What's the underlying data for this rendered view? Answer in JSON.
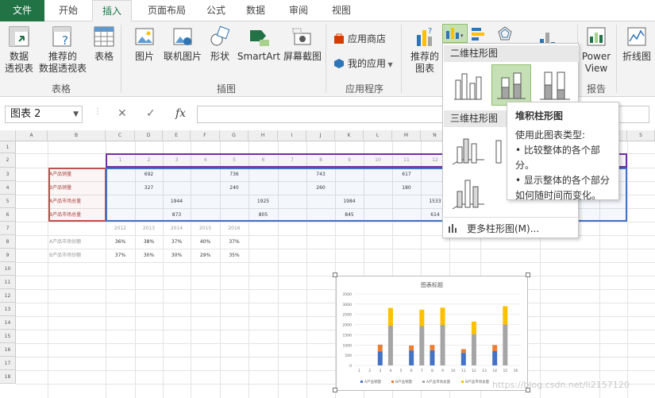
{
  "tabs": [
    {
      "label": "文件"
    },
    {
      "label": "开始"
    },
    {
      "label": "插入"
    },
    {
      "label": "页面布局"
    },
    {
      "label": "公式"
    },
    {
      "label": "数据"
    },
    {
      "label": "审阅"
    },
    {
      "label": "视图"
    }
  ],
  "ribbon": {
    "pivot_l1": "数据",
    "pivot_l2": "透视表",
    "rec_pivot_l1": "推荐的",
    "rec_pivot_l2": "数据透视表",
    "table": "表格",
    "group_tables": "表格",
    "picture": "图片",
    "online_picture": "联机图片",
    "shapes": "形状",
    "smartart": "SmartArt",
    "screenshot": "屏幕截图",
    "group_illustrations": "插图",
    "store": "应用商店",
    "my_apps": "我的应用",
    "group_apps": "应用程序",
    "rec_charts_l1": "推荐的",
    "rec_charts_l2": "图表",
    "power_view_l1": "Power",
    "power_view_l2": "View",
    "group_reports": "报告",
    "sparkline_line": "折线图"
  },
  "formula_bar": {
    "name_box": "图表 2",
    "fx": "fx",
    "cancel": "✕",
    "enter": "✓"
  },
  "column_dropdown": {
    "section_2d": "二维柱形图",
    "section_3d": "三维柱形图",
    "more": "更多柱形图(M)..."
  },
  "tooltip": {
    "title": "堆积柱形图",
    "line1": "使用此图表类型:",
    "line2": "• 比较整体的各个部",
    "line3": "分。",
    "line4": "• 显示整体的各个部分",
    "line5": "如何随时间而变化。"
  },
  "sheet": {
    "columns": [
      "A",
      "B",
      "C",
      "D",
      "E",
      "F",
      "G",
      "H",
      "I",
      "J",
      "K",
      "L",
      "M",
      "N",
      "O",
      "P",
      "Q",
      "R",
      "S"
    ],
    "rows": [
      "1",
      "2",
      "3",
      "4",
      "5",
      "6",
      "7",
      "8",
      "9",
      "10",
      "11",
      "12",
      "13",
      "14",
      "15",
      "16",
      "17",
      "18"
    ],
    "row2_nums": [
      "1",
      "2",
      "3",
      "4",
      "5",
      "6",
      "7",
      "8",
      "9",
      "10",
      "11",
      "12"
    ],
    "r3_label": "A产品销量",
    "r3": [
      "692",
      "736",
      "743",
      "617"
    ],
    "r4_label": "B产品销量",
    "r4": [
      "327",
      "240",
      "260",
      "180"
    ],
    "r5_label": "A产品市场总量",
    "r5": [
      "1944",
      "1925",
      "1984",
      "1533"
    ],
    "r6_label": "B产品市场总量",
    "r6": [
      "873",
      "805",
      "845",
      "614"
    ],
    "years": [
      "2012",
      "2013",
      "2014",
      "2015",
      "2016"
    ],
    "r8_label": "A产品市场份额",
    "r8": [
      "36%",
      "38%",
      "37%",
      "40%",
      "37%"
    ],
    "r9_label": "B产品市场份额",
    "r9": [
      "37%",
      "30%",
      "30%",
      "29%",
      "35%"
    ]
  },
  "chart_data": {
    "type": "bar",
    "title": "图表标题",
    "stacked": true,
    "x": [
      "1",
      "2",
      "3",
      "4",
      "5",
      "6",
      "7",
      "8",
      "9",
      "10",
      "11",
      "12",
      "13",
      "14",
      "15",
      "16"
    ],
    "ylim": [
      0,
      3500
    ],
    "yticks": [
      0,
      500,
      1000,
      1500,
      2000,
      2500,
      3000,
      3500
    ],
    "series": [
      {
        "name": "A产品销量",
        "color": "#4472c4",
        "values": [
          0,
          0,
          692,
          0,
          0,
          736,
          0,
          743,
          0,
          0,
          617,
          0,
          0,
          700,
          0,
          0
        ]
      },
      {
        "name": "B产品销量",
        "color": "#ed7d31",
        "values": [
          0,
          0,
          327,
          0,
          0,
          240,
          0,
          260,
          0,
          0,
          180,
          0,
          0,
          300,
          0,
          0
        ]
      },
      {
        "name": "A产品市场总量",
        "color": "#a5a5a5",
        "values": [
          0,
          0,
          0,
          1944,
          0,
          0,
          1925,
          0,
          1984,
          0,
          0,
          1533,
          0,
          0,
          2000,
          0
        ]
      },
      {
        "name": "B产品市场总量",
        "color": "#ffc000",
        "values": [
          0,
          0,
          0,
          873,
          0,
          0,
          805,
          0,
          845,
          0,
          0,
          614,
          0,
          0,
          900,
          0
        ]
      }
    ]
  },
  "watermark": "https://blog.csdn.net/li2157120"
}
